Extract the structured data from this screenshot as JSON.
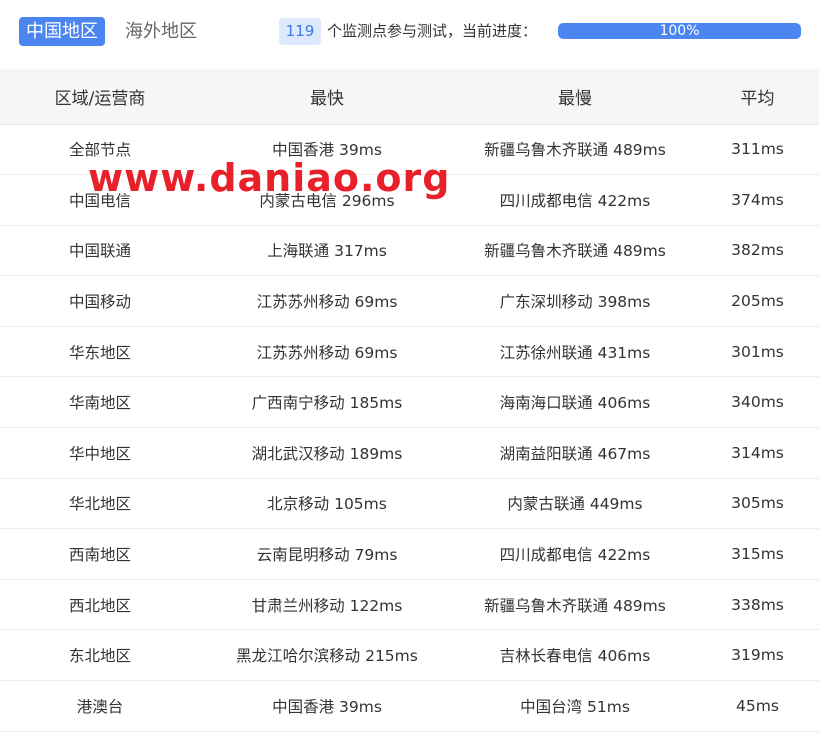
{
  "tabs": [
    {
      "label": "中国地区",
      "active": true
    },
    {
      "label": "海外地区",
      "active": false
    }
  ],
  "status": {
    "node_count": "119",
    "progress_text": "个监测点参与测试，当前进度：",
    "progress_label": "100%",
    "progress_fraction": 1.0
  },
  "table": {
    "headers": [
      "区域/运营商",
      "最快",
      "最慢",
      "平均"
    ],
    "rows": [
      [
        "全部节点",
        "中国香港 39ms",
        "新疆乌鲁木齐联通 489ms",
        "311ms"
      ],
      [
        "中国电信",
        "内蒙古电信 296ms",
        "四川成都电信 422ms",
        "374ms"
      ],
      [
        "中国联通",
        "上海联通 317ms",
        "新疆乌鲁木齐联通 489ms",
        "382ms"
      ],
      [
        "中国移动",
        "江苏苏州移动 69ms",
        "广东深圳移动 398ms",
        "205ms"
      ],
      [
        "华东地区",
        "江苏苏州移动 69ms",
        "江苏徐州联通 431ms",
        "301ms"
      ],
      [
        "华南地区",
        "广西南宁移动 185ms",
        "海南海口联通 406ms",
        "340ms"
      ],
      [
        "华中地区",
        "湖北武汉移动 189ms",
        "湖南益阳联通 467ms",
        "314ms"
      ],
      [
        "华北地区",
        "北京移动 105ms",
        "内蒙古联通 449ms",
        "305ms"
      ],
      [
        "西南地区",
        "云南昆明移动 79ms",
        "四川成都电信 422ms",
        "315ms"
      ],
      [
        "西北地区",
        "甘肃兰州移动 122ms",
        "新疆乌鲁木齐联通 489ms",
        "338ms"
      ],
      [
        "东北地区",
        "黑龙江哈尔滨移动 215ms",
        "吉林长春电信 406ms",
        "319ms"
      ],
      [
        "港澳台",
        "中国香港 39ms",
        "中国台湾 51ms",
        "45ms"
      ]
    ]
  },
  "watermark": "www.daniao.org",
  "colors": {
    "accent": "#4b86f0",
    "watermark": "#e8202a"
  }
}
